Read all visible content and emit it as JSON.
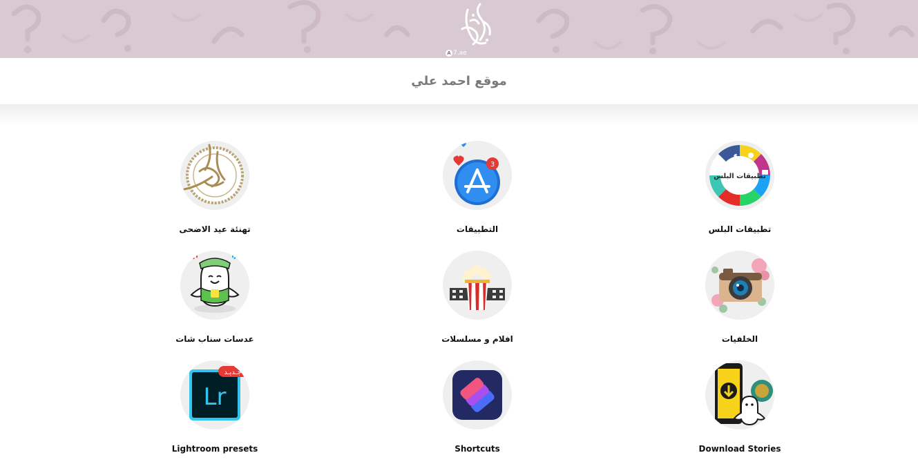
{
  "header": {
    "logo_name": "logo-calligraphy",
    "logo_caption_badge": "A",
    "logo_caption": "7.ae",
    "site_title": "موقع احمد علي"
  },
  "colors": {
    "banner": "#d9c9d1",
    "title_text": "#7a7a7a",
    "label_text": "#111111",
    "tile_circle": "#efefef"
  },
  "tiles": [
    {
      "label": "تطبيقات البلس",
      "icon": "plus-apps-icon",
      "icon_text": "تطبيقات البلس"
    },
    {
      "label": "التطبيقات",
      "icon": "app-store-icon",
      "badge": "3"
    },
    {
      "label": "تهنئة عيد الاضحى",
      "icon": "eid-calligraphy-icon"
    },
    {
      "label": "الخلفيات",
      "icon": "camera-flowers-icon"
    },
    {
      "label": "افلام و مسلسلات",
      "icon": "popcorn-film-icon"
    },
    {
      "label": "عدسات سناب شات",
      "icon": "snapchat-ghost-icon"
    },
    {
      "label": "Download Stories",
      "icon": "download-stories-icon"
    },
    {
      "label": "Shortcuts",
      "icon": "shortcuts-icon"
    },
    {
      "label": "Lightroom presets",
      "icon": "lightroom-icon",
      "icon_text": "Lr",
      "badge": "جـديـد"
    }
  ]
}
